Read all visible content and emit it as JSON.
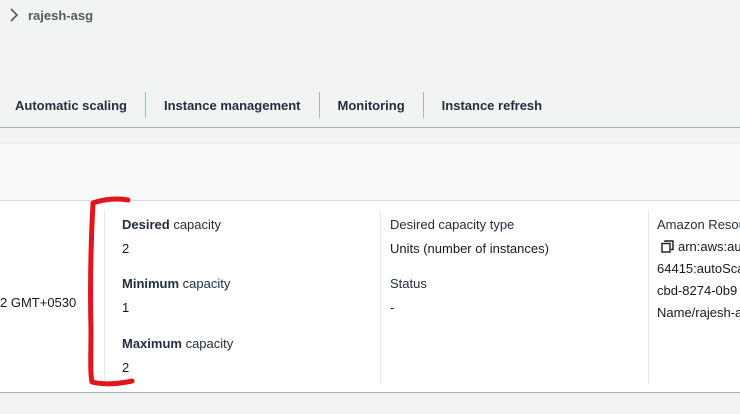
{
  "breadcrumb": {
    "label": "rajesh-asg",
    "icon": "chevron-right-icon"
  },
  "tabs": [
    {
      "label": "Automatic scaling"
    },
    {
      "label": "Instance management"
    },
    {
      "label": "Monitoring"
    },
    {
      "label": "Instance refresh"
    }
  ],
  "details": {
    "created_time_partial": "2 GMT+0530",
    "desired": {
      "label_bold": "Desired",
      "label_rest": " capacity",
      "value": "2"
    },
    "minimum": {
      "label_bold": "Minimum",
      "label_rest": " capacity",
      "value": "1"
    },
    "maximum": {
      "label_bold": "Maximum",
      "label_rest": " capacity",
      "value": "2"
    },
    "desired_capacity_type": {
      "label": "Desired capacity type",
      "value": "Units (number of instances)"
    },
    "status": {
      "label": "Status",
      "value": "-"
    },
    "arn": {
      "label": "Amazon Resou",
      "lines": [
        "arn:aws:aut",
        "64415:autoSca",
        "cbd-8274-0b9",
        "Name/rajesh-a"
      ]
    }
  },
  "colors": {
    "annotation": "#e3141b",
    "text_primary": "#16191f",
    "text_muted": "#545b64",
    "background": "#f2f3f3",
    "panel": "#ffffff"
  }
}
